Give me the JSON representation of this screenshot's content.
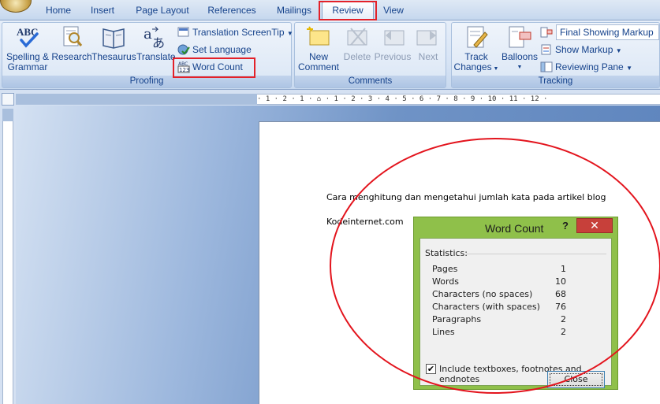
{
  "tabs": [
    "Home",
    "Insert",
    "Page Layout",
    "References",
    "Mailings",
    "Review",
    "View"
  ],
  "active_tab": "Review",
  "groups": {
    "proofing": {
      "label": "Proofing",
      "spelling_line1": "Spelling &",
      "spelling_line2": "Grammar",
      "research": "Research",
      "thesaurus": "Thesaurus",
      "translate": "Translate",
      "translation_screentip": "Translation ScreenTip",
      "set_language": "Set Language",
      "word_count": "Word Count"
    },
    "comments": {
      "label": "Comments",
      "new_line1": "New",
      "new_line2": "Comment",
      "delete": "Delete",
      "previous": "Previous",
      "next": "Next"
    },
    "tracking": {
      "label": "Tracking",
      "track_line1": "Track",
      "track_line2": "Changes",
      "balloons": "Balloons",
      "markup_select": "Final Showing Markup",
      "show_markup": "Show Markup",
      "reviewing_pane": "Reviewing Pane"
    }
  },
  "document": {
    "line1": "Cara menghitung dan mengetahui jumlah kata pada artikel blog",
    "line2": "Kodeinternet.com"
  },
  "dialog": {
    "title": "Word Count",
    "help": "?",
    "close_x": "✕",
    "statistics_label": "Statistics:",
    "stats": [
      {
        "name": "Pages",
        "value": "1"
      },
      {
        "name": "Words",
        "value": "10"
      },
      {
        "name": "Characters (no spaces)",
        "value": "68"
      },
      {
        "name": "Characters (with spaces)",
        "value": "76"
      },
      {
        "name": "Paragraphs",
        "value": "2"
      },
      {
        "name": "Lines",
        "value": "2"
      }
    ],
    "checkbox_label": "Include textboxes, footnotes and endnotes",
    "checkbox_checked": true,
    "close_button": "Close"
  },
  "ruler_marks": "· 1 · 2 · 1 · ⌂ · 1 · 2 · 3 · 4 · 5 · 6 · 7 · 8 · 9 · 10 · 11 · 12 ·"
}
